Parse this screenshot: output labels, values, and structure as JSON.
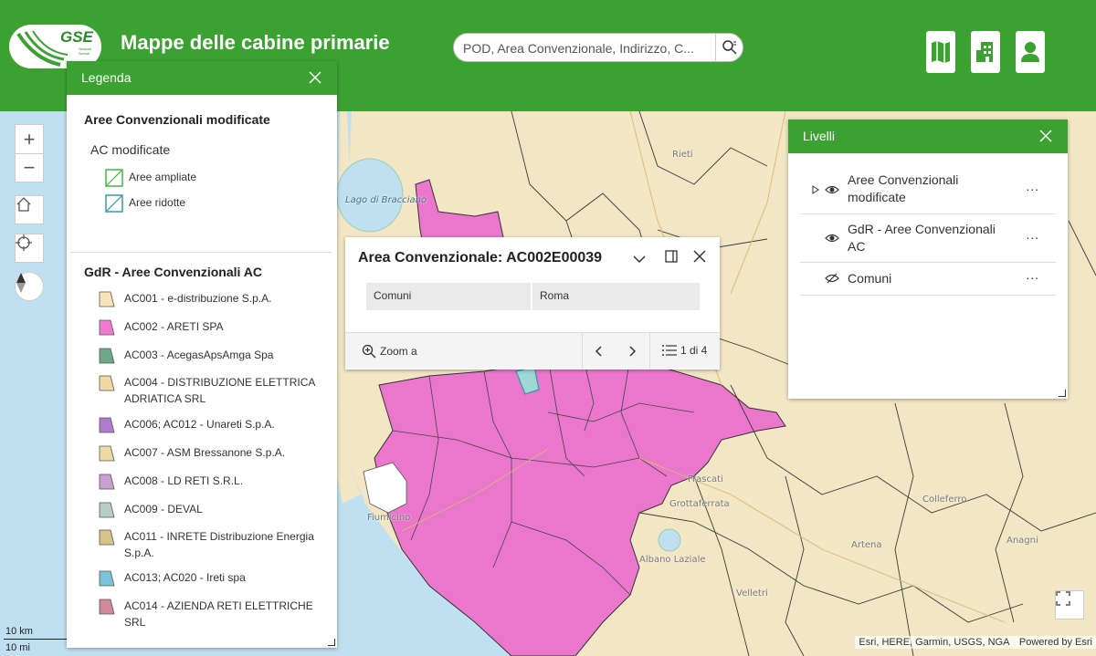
{
  "header": {
    "logo_text": "GSE",
    "logo_sub": "Gestore Servizi",
    "title": "Mappe delle cabine primarie",
    "search_placeholder": "POD, Area Convenzionale, Indirizzo, C...",
    "buttons": [
      "map-icon",
      "building-icon",
      "user-icon"
    ],
    "brand_color": "#3ba232"
  },
  "legend": {
    "title": "Legenda",
    "section1_title": "Aree Convenzionali modificate",
    "section1_subtitle": "AC modificate",
    "section1_items": [
      {
        "label": "Aree ampliate",
        "color": "#3cbb3c"
      },
      {
        "label": "Aree ridotte",
        "color": "#2aa0a0"
      }
    ],
    "section2_title": "GdR - Aree Convenzionali AC",
    "section2_items": [
      {
        "label": "AC001 - e-distribuzione S.p.A.",
        "color": "#f7e4b8"
      },
      {
        "label": "AC002 - ARETI SPA",
        "color": "#ef7ad0"
      },
      {
        "label": "AC003 - AcegasApsAmga Spa",
        "color": "#6fa886"
      },
      {
        "label": "AC004 - DISTRIBUZIONE ELETTRICA ADRIATICA SRL",
        "color": "#efd9a4"
      },
      {
        "label": "AC006; AC012 - Unareti S.p.A.",
        "color": "#b07cd0"
      },
      {
        "label": "AC007 - ASM Bressanone S.p.A.",
        "color": "#efd9a4"
      },
      {
        "label": "AC008 - LD RETI S.R.L.",
        "color": "#c99ed0"
      },
      {
        "label": "AC009 - DEVAL",
        "color": "#b6cec4"
      },
      {
        "label": "AC011 - INRETE Distribuzione Energia S.p.A.",
        "color": "#d8c488"
      },
      {
        "label": "AC013; AC020 - Ireti spa",
        "color": "#7cc2d8"
      },
      {
        "label": "AC014 - AZIENDA RETI ELETTRICHE SRL",
        "color": "#d0889c"
      }
    ]
  },
  "popup": {
    "title": "Area Convenzionale: AC002E00039",
    "field_name": "Comuni",
    "field_value": "Roma",
    "zoom_label": "Zoom a",
    "page_indicator": "1 di 4"
  },
  "layers": {
    "title": "Livelli",
    "items": [
      {
        "label": "Aree Convenzionali modificate",
        "visible": true,
        "expandable": true
      },
      {
        "label": "GdR - Aree Convenzionali AC",
        "visible": true,
        "expandable": false
      },
      {
        "label": "Comuni",
        "visible": false,
        "expandable": false
      }
    ],
    "more_label": "..."
  },
  "map": {
    "labels": [
      "Lago di Bracciano",
      "Rieti",
      "Fiumicino",
      "Albano Laziale",
      "Frascati",
      "Grottaferrata",
      "Velletri",
      "Artena",
      "Anagni",
      "Colleferro"
    ],
    "attribution": "Esri, HERE, Garmin, USGS, NGA",
    "powered_by": "Powered by Esri",
    "scale_km": "10 km",
    "scale_mi": "10 mi"
  }
}
